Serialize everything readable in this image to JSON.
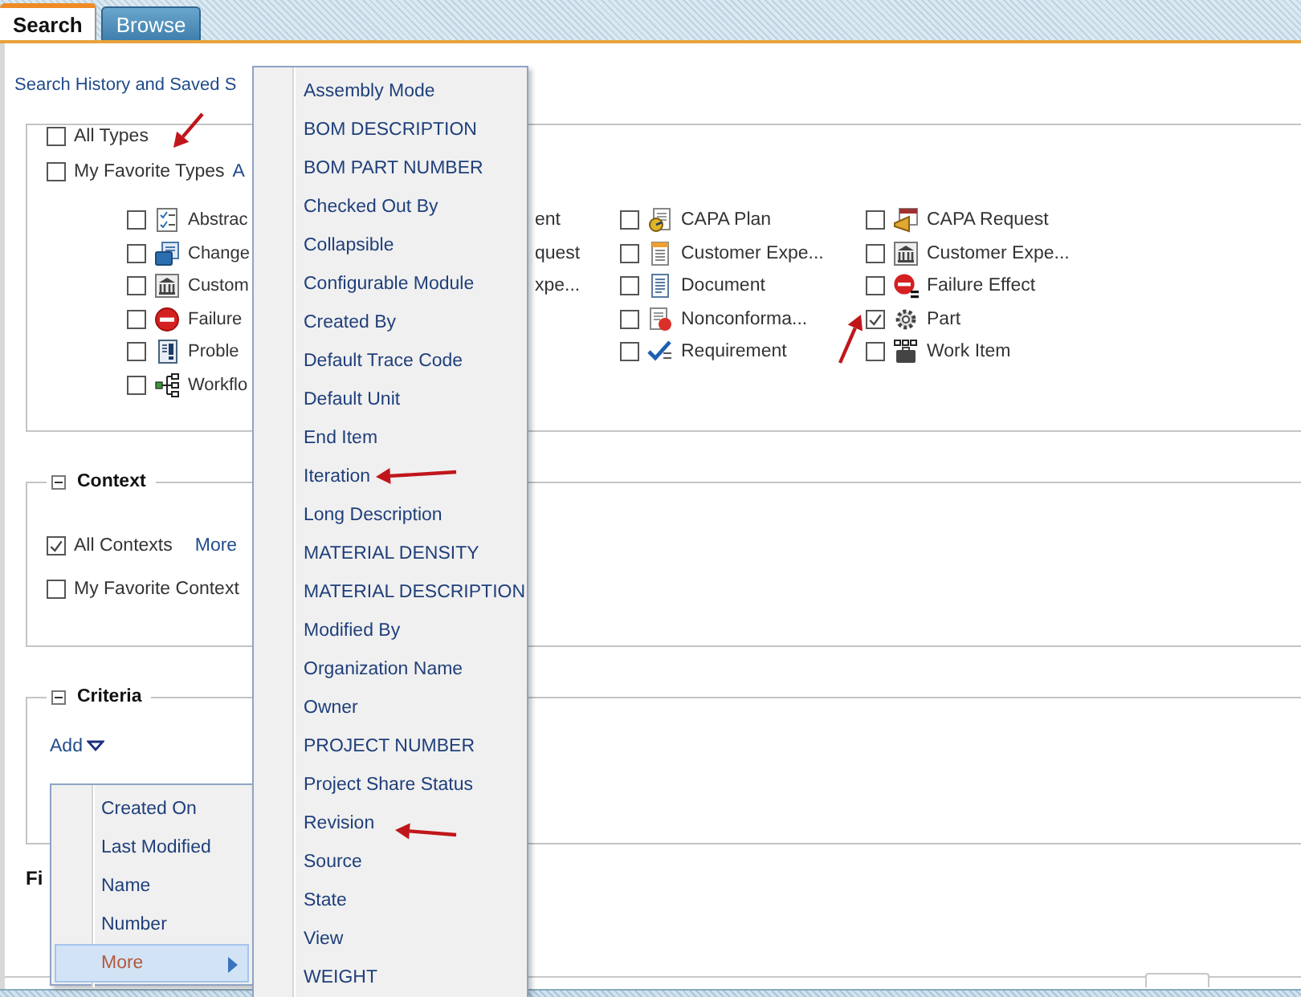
{
  "tabs": [
    {
      "label": "Search",
      "selected": true
    },
    {
      "label": "Browse",
      "selected": false
    }
  ],
  "history_link": "Search History and Saved S",
  "types": {
    "options": [
      {
        "label": "All Types",
        "checked": false
      },
      {
        "label": "My Favorite Types",
        "checked": false
      }
    ],
    "link": "A",
    "column_1": [
      {
        "label": "Abstrac",
        "checked": false
      },
      {
        "label": "Change",
        "checked": false
      },
      {
        "label": "Custom",
        "checked": false
      },
      {
        "label": "Failure",
        "checked": false
      },
      {
        "label": "Proble",
        "checked": false
      },
      {
        "label": "Workflo",
        "checked": false
      }
    ],
    "column_2": [
      "ent",
      "quest",
      "xpe..."
    ],
    "column_3": [
      {
        "label": "CAPA Plan",
        "checked": false
      },
      {
        "label": "Customer Expe...",
        "checked": false
      },
      {
        "label": "Document",
        "checked": false
      },
      {
        "label": "Nonconforma...",
        "checked": false
      },
      {
        "label": "Requirement",
        "checked": false
      }
    ],
    "column_4": [
      {
        "label": "CAPA Request",
        "checked": false
      },
      {
        "label": "Customer Expe...",
        "checked": false
      },
      {
        "label": "Failure Effect",
        "checked": false
      },
      {
        "label": "Part",
        "checked": true
      },
      {
        "label": "Work Item",
        "checked": false
      }
    ]
  },
  "context": {
    "legend": "Context",
    "options": [
      {
        "label": "All Contexts",
        "checked": true
      },
      {
        "label": "My Favorite Context",
        "checked": false
      }
    ],
    "link": "More"
  },
  "criteria": {
    "legend": "Criteria",
    "add_link": "Add"
  },
  "footer_label": "Fi",
  "criteria_menu": [
    {
      "label": "Created On",
      "selected": false
    },
    {
      "label": "Last Modified",
      "selected": false
    },
    {
      "label": "Name",
      "selected": false
    },
    {
      "label": "Number",
      "selected": false
    },
    {
      "label": "More",
      "selected": true
    }
  ],
  "more_submenu": [
    "Assembly Mode",
    "BOM DESCRIPTION",
    "BOM PART NUMBER",
    "Checked Out By",
    "Collapsible",
    "Configurable Module",
    "Created By",
    "Default Trace Code",
    "Default Unit",
    "End Item",
    "Iteration",
    "Long Description",
    "MATERIAL DENSITY",
    "MATERIAL DESCRIPTION",
    "Modified By",
    "Organization Name",
    "Owner",
    "PROJECT NUMBER",
    "Project Share Status",
    "Revision",
    "Source",
    "State",
    "View",
    "WEIGHT"
  ]
}
